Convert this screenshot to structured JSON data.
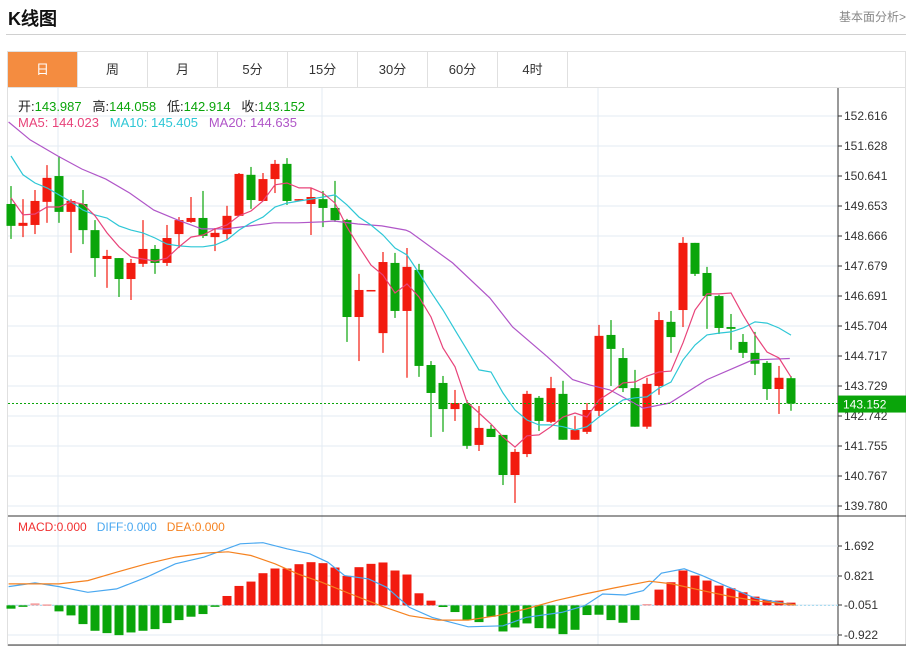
{
  "header": {
    "title": "K线图",
    "fundamentals_link": "基本面分析>"
  },
  "tabs": [
    {
      "label": "日",
      "active": true
    },
    {
      "label": "周"
    },
    {
      "label": "月"
    },
    {
      "label": "5分"
    },
    {
      "label": "15分"
    },
    {
      "label": "30分"
    },
    {
      "label": "60分"
    },
    {
      "label": "4时"
    }
  ],
  "colors": {
    "up": "#f21b0f",
    "down": "#0aa50a",
    "ma5": "#e8437a",
    "ma10": "#2ec7d6",
    "ma20": "#b056c8",
    "diff": "#4aa8f0",
    "dea": "#f58220",
    "macd": "#f03030",
    "accent": "#f48c40"
  },
  "ohlc_info": {
    "open_label": "开:",
    "open": "143.987",
    "high_label": "高:",
    "high": "144.058",
    "low_label": "低:",
    "low": "142.914",
    "close_label": "收:",
    "close": "143.152"
  },
  "ma_info": {
    "ma5": "MA5: 144.023",
    "ma10": "MA10: 145.405",
    "ma20": "MA20: 144.635"
  },
  "macd_info": {
    "macd": "MACD:0.000",
    "diff": "DIFF:0.000",
    "dea": "DEA:0.000"
  },
  "current_price": "143.152",
  "chart_data": {
    "type": "candlestick",
    "price_ticks": [
      "152.616",
      "151.628",
      "150.641",
      "149.653",
      "148.666",
      "147.679",
      "146.691",
      "145.704",
      "144.717",
      "143.729",
      "142.742",
      "141.755",
      "140.767",
      "139.780"
    ],
    "price_range": [
      139.78,
      152.616
    ],
    "candles": [
      [
        149.72,
        150.31,
        148.57,
        149.0
      ],
      [
        149.0,
        149.88,
        148.63,
        149.1
      ],
      [
        149.03,
        150.18,
        148.73,
        149.82
      ],
      [
        149.79,
        151.0,
        149.1,
        150.58
      ],
      [
        150.64,
        151.3,
        149.1,
        149.46
      ],
      [
        149.46,
        149.88,
        148.11,
        149.82
      ],
      [
        149.72,
        150.18,
        148.4,
        148.86
      ],
      [
        148.86,
        149.19,
        147.32,
        147.94
      ],
      [
        147.91,
        148.21,
        146.96,
        148.01
      ],
      [
        147.94,
        147.94,
        146.66,
        147.25
      ],
      [
        147.25,
        147.91,
        146.56,
        147.78
      ],
      [
        147.75,
        149.19,
        147.65,
        148.24
      ],
      [
        148.24,
        148.37,
        147.42,
        147.78
      ],
      [
        147.78,
        149.03,
        147.68,
        148.6
      ],
      [
        148.73,
        149.29,
        148.27,
        149.19
      ],
      [
        149.13,
        149.95,
        149.1,
        149.26
      ],
      [
        149.26,
        150.15,
        148.6,
        148.67
      ],
      [
        148.63,
        148.93,
        148.17,
        148.77
      ],
      [
        148.73,
        149.66,
        148.57,
        149.33
      ],
      [
        149.33,
        150.74,
        149.33,
        150.71
      ],
      [
        150.68,
        150.94,
        149.56,
        149.85
      ],
      [
        149.82,
        150.74,
        149.82,
        150.54
      ],
      [
        150.54,
        151.17,
        150.08,
        151.04
      ],
      [
        151.04,
        151.23,
        149.69,
        149.82
      ],
      [
        149.85,
        149.88,
        149.82,
        149.88
      ],
      [
        149.72,
        150.25,
        148.7,
        149.95
      ],
      [
        149.88,
        150.15,
        148.96,
        149.59
      ],
      [
        149.59,
        150.48,
        149.13,
        149.19
      ],
      [
        149.19,
        149.23,
        145.18,
        146.0
      ],
      [
        146.0,
        147.42,
        144.55,
        146.89
      ],
      [
        146.86,
        146.89,
        146.86,
        146.89
      ],
      [
        145.47,
        148.14,
        144.82,
        147.81
      ],
      [
        147.78,
        148.11,
        145.97,
        146.2
      ],
      [
        146.2,
        148.27,
        144.0,
        147.65
      ],
      [
        147.55,
        147.75,
        144.03,
        144.39
      ],
      [
        144.42,
        144.55,
        142.05,
        143.5
      ],
      [
        143.83,
        144.06,
        142.22,
        142.97
      ],
      [
        142.97,
        143.6,
        142.58,
        143.17
      ],
      [
        143.14,
        143.27,
        141.66,
        141.76
      ],
      [
        141.79,
        143.07,
        141.59,
        142.35
      ],
      [
        142.32,
        142.45,
        142.05,
        142.05
      ],
      [
        142.12,
        142.12,
        140.47,
        140.8
      ],
      [
        140.8,
        141.66,
        139.88,
        141.56
      ],
      [
        141.49,
        143.57,
        141.39,
        143.47
      ],
      [
        143.34,
        143.4,
        142.25,
        142.58
      ],
      [
        142.55,
        144.03,
        142.51,
        143.66
      ],
      [
        143.47,
        143.9,
        141.96,
        141.96
      ],
      [
        141.96,
        142.74,
        141.96,
        142.28
      ],
      [
        142.22,
        143.17,
        142.15,
        142.94
      ],
      [
        142.91,
        145.74,
        142.74,
        145.38
      ],
      [
        145.41,
        145.9,
        143.73,
        144.95
      ],
      [
        144.65,
        144.98,
        143.53,
        143.66
      ],
      [
        143.66,
        144.26,
        142.39,
        142.39
      ],
      [
        142.39,
        144.0,
        142.32,
        143.8
      ],
      [
        143.73,
        146.17,
        143.44,
        145.9
      ],
      [
        145.84,
        146.2,
        144.82,
        145.34
      ],
      [
        146.23,
        148.63,
        145.67,
        148.44
      ],
      [
        148.44,
        148.44,
        147.35,
        147.42
      ],
      [
        147.45,
        147.65,
        145.61,
        146.69
      ],
      [
        146.69,
        146.73,
        145.44,
        145.64
      ],
      [
        145.67,
        146.1,
        144.92,
        145.61
      ],
      [
        145.18,
        145.44,
        144.65,
        144.82
      ],
      [
        144.82,
        145.51,
        144.09,
        144.46
      ],
      [
        144.49,
        144.55,
        143.27,
        143.63
      ],
      [
        143.63,
        144.39,
        142.81,
        144.0
      ],
      [
        143.987,
        144.058,
        142.914,
        143.152
      ]
    ],
    "ma5": [
      149.92,
      149.36,
      149.39,
      149.62,
      149.62,
      149.79,
      149.72,
      149.33,
      148.77,
      148.31,
      147.98,
      147.91,
      147.84,
      147.94,
      148.31,
      148.63,
      148.7,
      148.9,
      149.03,
      149.33,
      149.49,
      149.82,
      150.35,
      150.41,
      150.25,
      150.25,
      150.08,
      149.75,
      148.96,
      148.31,
      147.71,
      147.38,
      146.79,
      147.09,
      146.66,
      146.0,
      144.98,
      144.36,
      143.2,
      142.84,
      142.48,
      142.05,
      141.72,
      142.09,
      142.12,
      142.39,
      142.71,
      142.84,
      142.71,
      143.27,
      143.53,
      143.83,
      143.86,
      144.06,
      144.19,
      144.22,
      145.15,
      146.23,
      146.76,
      146.76,
      146.79,
      146.07,
      145.41,
      144.85,
      144.65,
      144.023
    ],
    "ma10": [
      151.3,
      150.68,
      150.41,
      150.25,
      150.02,
      149.79,
      149.52,
      149.36,
      149.26,
      149.0,
      148.86,
      148.77,
      148.6,
      148.4,
      148.34,
      148.31,
      148.31,
      148.37,
      148.54,
      148.86,
      149.1,
      149.29,
      149.62,
      149.75,
      149.82,
      149.88,
      149.95,
      150.02,
      149.69,
      149.29,
      149.03,
      148.7,
      148.27,
      148.04,
      147.45,
      146.82,
      146.23,
      145.57,
      144.92,
      144.26,
      144.19,
      143.5,
      142.94,
      142.61,
      142.45,
      142.45,
      142.39,
      142.28,
      142.39,
      142.71,
      143.0,
      143.27,
      143.34,
      143.37,
      143.66,
      143.86,
      144.59,
      145.08,
      145.41,
      145.47,
      145.51,
      145.64,
      145.84,
      145.8,
      145.64,
      145.405
    ],
    "ma20": [
      [
        -0.2,
        152.42
      ],
      [
        1.6,
        151.83
      ],
      [
        3.9,
        151.3
      ],
      [
        5.9,
        150.87
      ],
      [
        7.9,
        150.54
      ],
      [
        9.9,
        150.08
      ],
      [
        11.9,
        149.52
      ],
      [
        13.9,
        149.19
      ],
      [
        15.9,
        148.9
      ],
      [
        17.9,
        148.9
      ],
      [
        19.9,
        149.0
      ],
      [
        21.9,
        149.1
      ],
      [
        23.9,
        149.1
      ],
      [
        25.9,
        149.13
      ],
      [
        26.9,
        149.16
      ],
      [
        28.9,
        149.06
      ],
      [
        30.9,
        149.0
      ],
      [
        32.9,
        148.86
      ],
      [
        33.25,
        148.8
      ],
      [
        36.8,
        147.78
      ],
      [
        39.9,
        146.63
      ],
      [
        41.8,
        145.67
      ],
      [
        44.7,
        144.69
      ],
      [
        46.8,
        143.94
      ],
      [
        48.25,
        143.76
      ],
      [
        49.9,
        143.6
      ],
      [
        52.7,
        143.0
      ],
      [
        54.9,
        143.17
      ],
      [
        58,
        143.94
      ],
      [
        61.8,
        144.59
      ],
      [
        64.9,
        144.635
      ]
    ],
    "macd_ticks": [
      "1.692",
      "0.821",
      "-0.051",
      "-0.922"
    ],
    "macd_baseline": -0.051,
    "macd_hist": [
      -0.098,
      -0.039,
      0.059,
      0.029,
      -0.177,
      -0.295,
      -0.551,
      -0.747,
      -0.816,
      -0.875,
      -0.796,
      -0.747,
      -0.698,
      -0.521,
      -0.433,
      -0.334,
      -0.256,
      -0.029,
      0.275,
      0.57,
      0.698,
      0.944,
      1.082,
      1.082,
      1.209,
      1.268,
      1.239,
      1.111,
      0.865,
      1.121,
      1.219,
      1.259,
      1.023,
      0.905,
      0.354,
      0.138,
      -0.049,
      -0.197,
      -0.433,
      -0.492,
      -0.334,
      -0.767,
      -0.649,
      -0.531,
      -0.669,
      -0.678,
      -0.846,
      -0.718,
      -0.285,
      -0.275,
      -0.433,
      -0.511,
      -0.433,
      0.039,
      0.462,
      0.678,
      1.023,
      0.875,
      0.728,
      0.58,
      0.501,
      0.383,
      0.256,
      0.157,
      0.138,
      0.079
    ],
    "diff": [
      [
        -0.2,
        0.5
      ],
      [
        2.0,
        0.608
      ],
      [
        4.0,
        0.5
      ],
      [
        6.4,
        0.332
      ],
      [
        8.8,
        0.431
      ],
      [
        11.3,
        0.775
      ],
      [
        13.7,
        1.168
      ],
      [
        16.1,
        1.365
      ],
      [
        19.1,
        1.758
      ],
      [
        21.0,
        1.788
      ],
      [
        23.0,
        1.611
      ],
      [
        24.9,
        1.463
      ],
      [
        26.4,
        1.217
      ],
      [
        27.8,
        0.824
      ],
      [
        29.8,
        0.726
      ],
      [
        31.3,
        0.48
      ],
      [
        33.2,
        -0.11
      ],
      [
        35.1,
        -0.405
      ],
      [
        38.1,
        -0.68
      ],
      [
        41.0,
        -0.651
      ],
      [
        42.9,
        -0.405
      ],
      [
        45.9,
        -0.257
      ],
      [
        47.8,
        -0.061
      ],
      [
        49.3,
        0.283
      ],
      [
        51.2,
        0.254
      ],
      [
        52.7,
        0.382
      ],
      [
        54.2,
        0.893
      ],
      [
        56.1,
        1.021
      ],
      [
        57.6,
        0.824
      ],
      [
        59.5,
        0.529
      ],
      [
        62.0,
        0.165
      ],
      [
        64.4,
        0.008
      ],
      [
        65.4,
        -0.041
      ]
    ],
    "dea": [
      [
        -0.2,
        0.578
      ],
      [
        4.0,
        0.578
      ],
      [
        6.4,
        0.677
      ],
      [
        8.8,
        0.922
      ],
      [
        11.3,
        1.168
      ],
      [
        13.7,
        1.365
      ],
      [
        16.1,
        1.483
      ],
      [
        18.1,
        1.522
      ],
      [
        20.0,
        1.414
      ],
      [
        22.0,
        1.168
      ],
      [
        23.9,
        0.873
      ],
      [
        25.9,
        0.627
      ],
      [
        28.3,
        0.283
      ],
      [
        30.8,
        -0.061
      ],
      [
        33.2,
        -0.356
      ],
      [
        35.6,
        -0.484
      ],
      [
        38.1,
        -0.484
      ],
      [
        40.5,
        -0.356
      ],
      [
        42.9,
        -0.159
      ],
      [
        45.4,
        0.087
      ],
      [
        47.8,
        0.283
      ],
      [
        50.3,
        0.46
      ],
      [
        53.2,
        0.657
      ],
      [
        55.1,
        0.578
      ],
      [
        57.6,
        0.382
      ],
      [
        60.0,
        0.205
      ],
      [
        62.4,
        0.067
      ],
      [
        65.4,
        -0.041
      ]
    ]
  }
}
